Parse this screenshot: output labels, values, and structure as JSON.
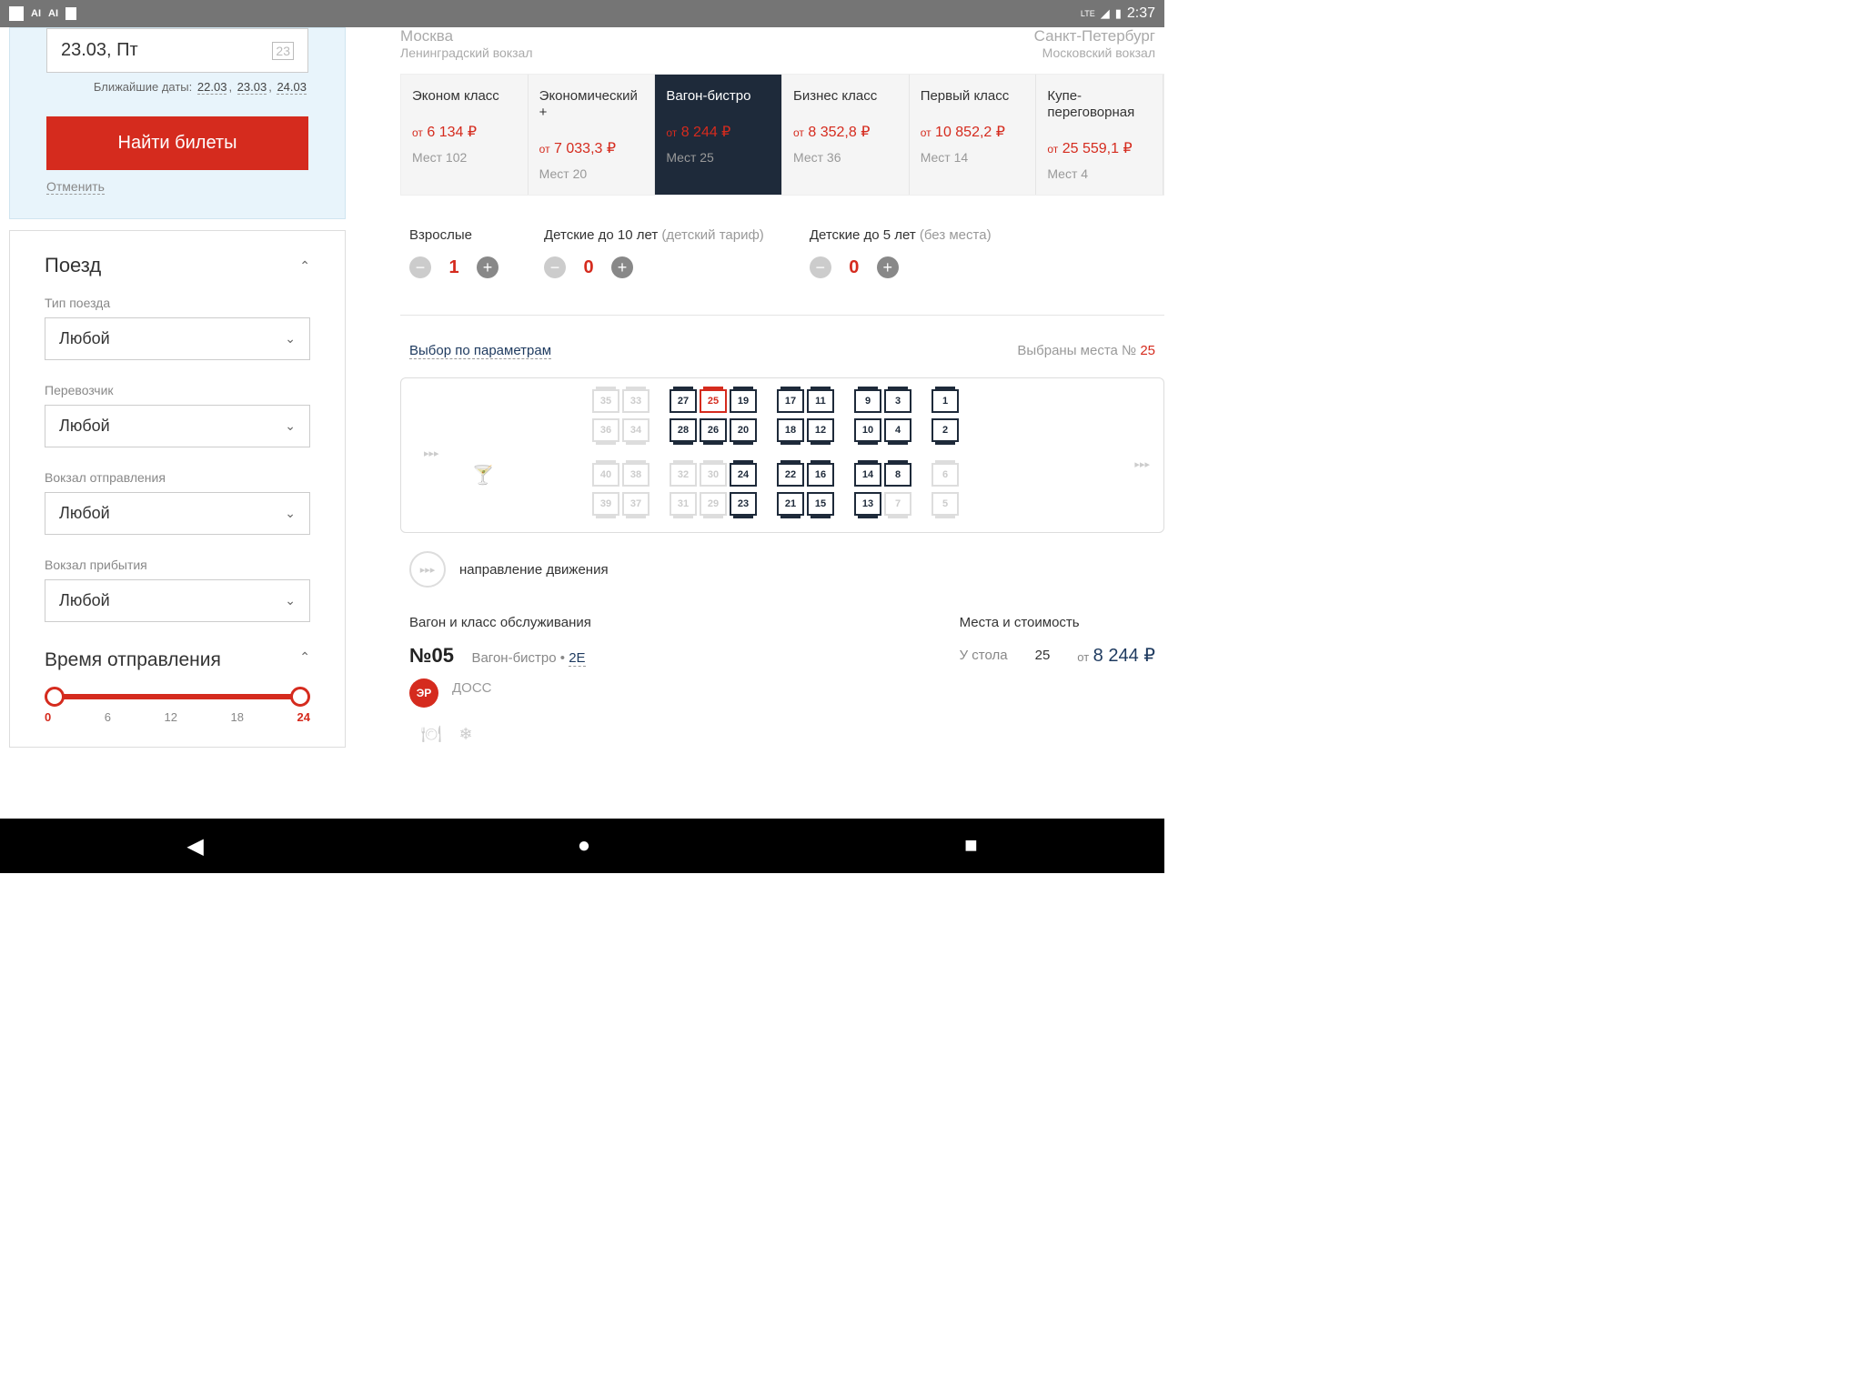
{
  "status": {
    "time": "2:37",
    "lte": "LTE",
    "ai": "AI"
  },
  "search": {
    "date": "23.03, Пт",
    "nearest_label": "Ближайшие даты:",
    "dates": [
      "22.03",
      "23.03",
      "24.03"
    ],
    "btn": "Найти билеты",
    "cancel": "Отменить"
  },
  "filters": {
    "train_title": "Поезд",
    "type_label": "Тип поезда",
    "type_value": "Любой",
    "carrier_label": "Перевозчик",
    "carrier_value": "Любой",
    "dep_station_label": "Вокзал отправления",
    "dep_station_value": "Любой",
    "arr_station_label": "Вокзал прибытия",
    "arr_station_value": "Любой",
    "dep_time_title": "Время отправления",
    "slider": [
      "0",
      "6",
      "12",
      "18",
      "24"
    ]
  },
  "route": {
    "from_city": "Москва",
    "from_station": "Ленинградский вокзал",
    "to_city": "Санкт-Петербург",
    "to_station": "Московский вокзал"
  },
  "classes": [
    {
      "name": "Эконом класс",
      "from": "от",
      "price": "6 134 ₽",
      "seats": "Мест 102"
    },
    {
      "name": "Экономический +",
      "from": "от",
      "price": "7 033,3 ₽",
      "seats": "Мест 20"
    },
    {
      "name": "Вагон-бистро",
      "from": "от",
      "price": "8 244 ₽",
      "seats": "Мест 25"
    },
    {
      "name": "Бизнес класс",
      "from": "от",
      "price": "8 352,8 ₽",
      "seats": "Мест 36"
    },
    {
      "name": "Первый класс",
      "from": "от",
      "price": "10 852,2 ₽",
      "seats": "Мест 14"
    },
    {
      "name": "Купе-переговорная",
      "from": "от",
      "price": "25 559,1 ₽",
      "seats": "Мест 4"
    }
  ],
  "passengers": {
    "adults_label": "Взрослые",
    "adults": "1",
    "children_label": "Детские до 10 лет",
    "children_sub": "(детский тариф)",
    "children": "0",
    "infants_label": "Детские до 5 лет",
    "infants_sub": "(без места)",
    "infants": "0"
  },
  "seatmap": {
    "param_link": "Выбор по параметрам",
    "selected_label": "Выбраны места №",
    "selected_num": "25",
    "top1": [
      "35",
      "33",
      "27",
      "25",
      "19",
      "17",
      "11",
      "9",
      "3",
      "1"
    ],
    "top2": [
      "36",
      "34",
      "28",
      "26",
      "20",
      "18",
      "12",
      "10",
      "4",
      "2"
    ],
    "bot1": [
      "40",
      "38",
      "32",
      "30",
      "24",
      "22",
      "16",
      "14",
      "8",
      "6"
    ],
    "bot2": [
      "39",
      "37",
      "31",
      "29",
      "23",
      "21",
      "15",
      "13",
      "7",
      "5"
    ]
  },
  "direction": "направление движения",
  "car": {
    "title": "Вагон и класс обслуживания",
    "number": "№05",
    "class": "Вагон-бистро",
    "code": "2Е",
    "er": "ЭР",
    "doss": "ДОСС",
    "price_title": "Места и стоимость",
    "table": "У стола",
    "seat": "25",
    "from": "от",
    "price": "8 244 ₽"
  }
}
